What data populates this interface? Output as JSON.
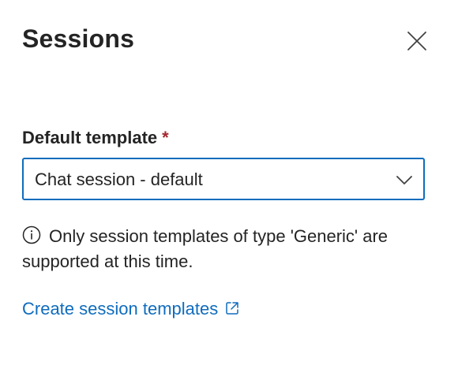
{
  "panel": {
    "title": "Sessions",
    "close_icon": "close-icon"
  },
  "form": {
    "template_label": "Default template",
    "required_marker": "*",
    "selected_value": "Chat session - default",
    "chevron_icon": "chevron-down-icon"
  },
  "info": {
    "icon": "info-icon",
    "message": "Only session templates of type 'Generic' are supported at this time."
  },
  "link": {
    "label": "Create session templates",
    "icon": "external-link-icon"
  },
  "colors": {
    "accent": "#0f6cbd",
    "required": "#a4262c",
    "text": "#242424"
  }
}
